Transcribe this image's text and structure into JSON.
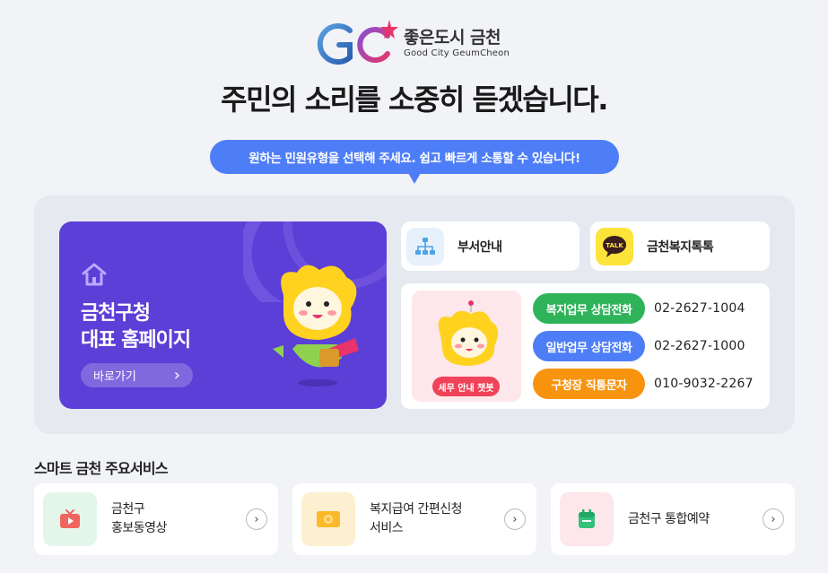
{
  "logo": {
    "korean": "좋은도시 금천",
    "english": "Good City GeumCheon"
  },
  "headline": "주민의 소리를 소중히 듣겠습니다.",
  "bubble": "원하는 민원유형을 선택해 주세요.  쉽고 빠르게 소통할 수 있습니다!",
  "hero": {
    "title_line1": "금천구청",
    "title_line2": "대표 홈페이지",
    "button_label": "바로가기",
    "button_arrow": "›"
  },
  "quick": {
    "dept_label": "부서안내",
    "kakao_label": "금천복지톡톡",
    "kakao_icon_text": "TALK"
  },
  "chatbot": {
    "button_label": "세무 안내 챗봇"
  },
  "contacts": [
    {
      "label": "복지업무 상담전화",
      "number": "02-2627-1004",
      "color": "#2fb35a"
    },
    {
      "label": "일반업무 상담전화",
      "number": "02-2627-1000",
      "color": "#4e7ef7"
    },
    {
      "label": "구청장 직통문자",
      "number": "010-9032-2267",
      "color": "#f7930c"
    }
  ],
  "services": {
    "title": "스마트 금천 주요서비스",
    "items": [
      {
        "line1": "금천구",
        "line2": "홍보동영상",
        "icon": "tv-icon"
      },
      {
        "line1": "복지급여 간편신청",
        "line2": "서비스",
        "icon": "wallet-icon"
      },
      {
        "line1": "금천구 통합예약",
        "line2": "",
        "icon": "calendar-icon"
      }
    ],
    "arrow": "›"
  },
  "colors": {
    "hero_bg": "#5b3fd6",
    "accent_blue": "#4e7ef7",
    "green": "#2fb35a",
    "orange": "#f7930c",
    "chatbot_pink": "#f0435a"
  }
}
